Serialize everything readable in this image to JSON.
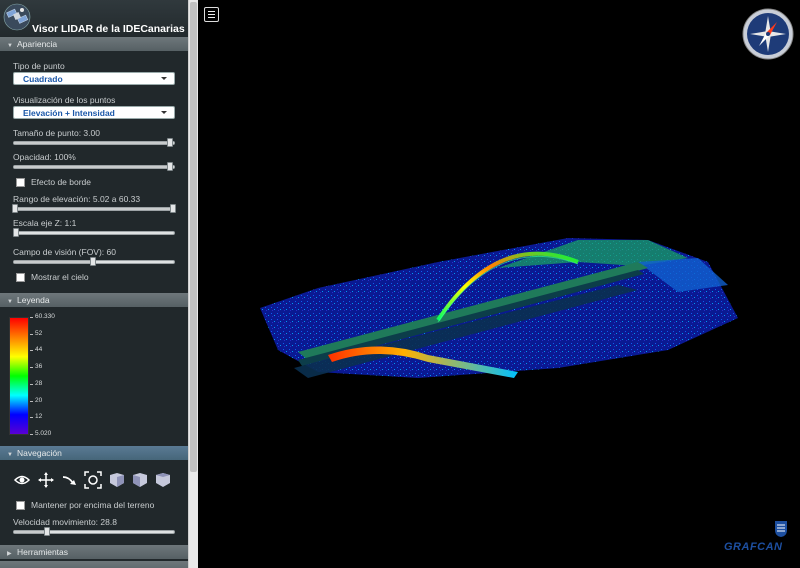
{
  "app": {
    "title": "Visor LIDAR de la IDECanarias"
  },
  "sections": {
    "apariencia": "Apariencia",
    "leyenda": "Leyenda",
    "navegacion": "Navegación",
    "herramientas": "Herramientas"
  },
  "apariencia": {
    "point_type_label": "Tipo de punto",
    "point_type_value": "Cuadrado",
    "visualization_label": "Visualización de los puntos",
    "visualization_value": "Elevación + Intensidad",
    "point_size_label": "Tamaño de punto: 3.00",
    "point_size_level": 1.0,
    "opacity_label": "Opacidad: 100%",
    "opacity_level": 1.0,
    "edge_effect_label": "Efecto de borde",
    "edge_effect_checked": false,
    "elevation_range_label": "Rango de elevación: 5.02 a 60.33",
    "elevation_range_low": 0.0,
    "elevation_range_high": 1.0,
    "z_scale_label": "Escala eje Z: 1:1",
    "z_scale_level": 0.0,
    "fov_label": "Campo de visión (FOV): 60",
    "fov_level": 0.5,
    "show_sky_label": "Mostrar el cielo",
    "show_sky_checked": false
  },
  "legend": {
    "ticks": [
      "60.330",
      "52",
      "44",
      "36",
      "28",
      "20",
      "12",
      "5.020"
    ],
    "colors": [
      "#ff0000",
      "#ff7f00",
      "#ffff00",
      "#00ff00",
      "#00ffff",
      "#0000ff",
      "#5a00d2"
    ]
  },
  "navegacion": {
    "icons": [
      "eye-orbit-icon",
      "pan-icon",
      "fly-icon",
      "zoom-extent-icon",
      "view-front-icon",
      "view-side-icon",
      "view-top-icon"
    ],
    "keep_above_terrain_label": "Mantener por encima del terreno",
    "keep_above_terrain_checked": false,
    "speed_label": "Velocidad movimiento: 28.8",
    "speed_level": 0.2
  },
  "viewer": {
    "logo_text": "GRAFCAN"
  }
}
